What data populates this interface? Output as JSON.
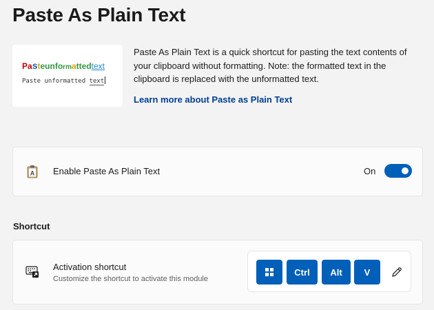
{
  "page": {
    "title": "Paste As Plain Text"
  },
  "hero": {
    "preview_formatted": [
      "Pa",
      "s",
      "t",
      "e ",
      "unfo",
      "rm",
      "a",
      "tt",
      "ed ",
      "text"
    ],
    "preview_formatted_colors": [
      "#c00000",
      "#1e5fb4",
      "#d8a400",
      "#2e9a3e",
      "#2e9a3e",
      "#2e9a3e",
      "#d8a400",
      "#2e9a3e",
      "#2e9a3e",
      "#1e88d8"
    ],
    "preview_plain_prefix": "Paste unformatted ",
    "preview_plain_underlined": "text"
  },
  "description": {
    "text": "Paste As Plain Text is a quick shortcut for pasting the text contents of your clipboard without formatting. Note: the formatted text in the clipboard is replaced with the unformatted text.",
    "link_label": "Learn more about Paste as Plain Text"
  },
  "enable": {
    "icon": "paste-plain-text-icon",
    "label": "Enable Paste As Plain Text",
    "state_label": "On",
    "enabled": true
  },
  "shortcut_section": {
    "title": "Shortcut",
    "icon": "keyboard-shortcut-icon",
    "setting_title": "Activation shortcut",
    "setting_description": "Customize the shortcut to activate this module",
    "keys": [
      {
        "type": "windows-icon",
        "label": ""
      },
      {
        "type": "text",
        "label": "Ctrl"
      },
      {
        "type": "text",
        "label": "Alt"
      },
      {
        "type": "text",
        "label": "V"
      }
    ],
    "edit_icon": "pencil-icon"
  },
  "colors": {
    "accent": "#005fb8",
    "link": "#003e92",
    "background": "#f3f3f3",
    "card": "#fbfbfb"
  }
}
